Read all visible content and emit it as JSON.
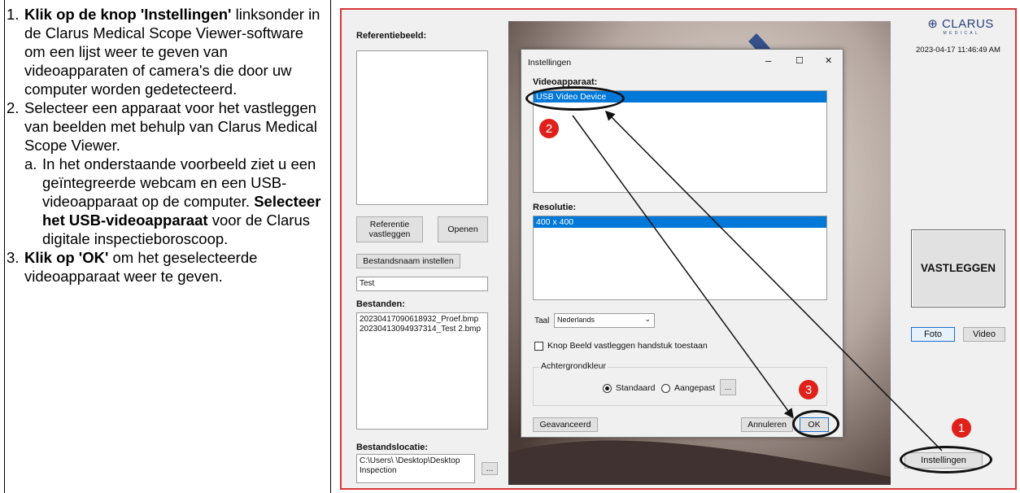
{
  "instructions": {
    "step1_num": "1.",
    "step1_bold": "Klik op de knop 'Instellingen'",
    "step1_rest": "linksonder in de Clarus Medical Scope Viewer-software om een lijst weer te geven van videoapparaten of camera's die door uw computer worden gedetecteerd.",
    "step2_num": "2.",
    "step2_text": "Selecteer een apparaat voor het vastleggen van beelden met behulp van Clarus Medical Scope Viewer.",
    "step2a_num": "a.",
    "step2a_text": "In het onderstaande voorbeeld ziet u een geïntegreerde webcam en een USB-videoapparaat op de computer.",
    "step2a_bold": "Selecteer het USB-videoapparaat",
    "step2a_rest": "voor de Clarus digitale inspectieboroscoop.",
    "step3_num": "3.",
    "step3_bold": "Klik op 'OK'",
    "step3_rest": "om het geselecteerde videoapparaat weer te geven."
  },
  "app": {
    "reference_label": "Referentiebeeld:",
    "capture_reference_button": "Referentie vastleggen",
    "open_button": "Openen",
    "set_filename_button": "Bestandsnaam instellen",
    "filename_value": "Test",
    "files_label": "Bestanden:",
    "files": [
      "20230417090618932_Proef.bmp",
      "20230413094937314_Test 2.bmp"
    ],
    "file_location_label": "Bestandslocatie:",
    "file_location_value": "C:\\Users\\ \\Desktop\\Desktop Inspection",
    "browse_button": "...",
    "brand_logo": "CLARUS",
    "brand_sub": "M E D I C A L",
    "timestamp": "2023-04-17 11:46:49 AM",
    "capture_button": "VASTLEGGEN",
    "photo_button": "Foto",
    "video_button": "Video",
    "settings_button": "Instellingen"
  },
  "dialog": {
    "title": "Instellingen",
    "minimize": "–",
    "maximize": "☐",
    "close": "✕",
    "video_device_label": "Videoapparaat:",
    "video_devices": [
      "USB Video Device"
    ],
    "resolution_label": "Resolutie:",
    "resolutions": [
      "400 x 400"
    ],
    "language_label": "Taal",
    "language_value": "Nederlands",
    "allow_handpiece_capture": "Knop Beeld vastleggen handstuk toestaan",
    "background_color_label": "Achtergrondkleur",
    "radio_standard": "Standaard",
    "radio_custom": "Aangepast",
    "custom_button": "...",
    "advanced_button": "Geavanceerd",
    "cancel_button": "Annuleren",
    "ok_button": "OK"
  },
  "callouts": {
    "c1": "1",
    "c2": "2",
    "c3": "3",
    "color": "#e0201b"
  }
}
